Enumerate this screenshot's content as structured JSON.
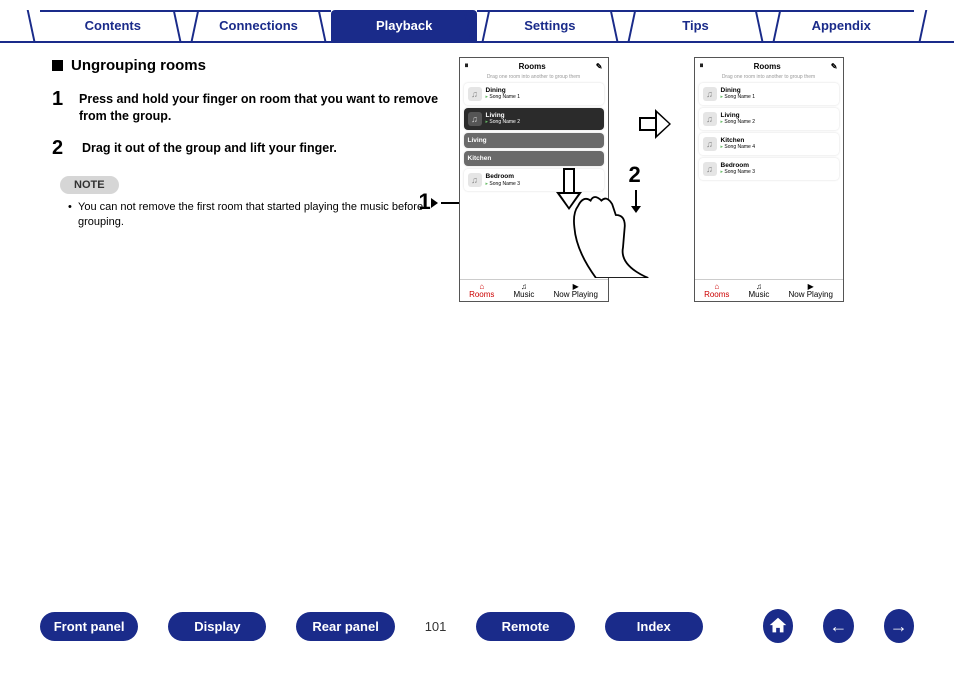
{
  "tabs": {
    "contents": "Contents",
    "connections": "Connections",
    "playback": "Playback",
    "settings": "Settings",
    "tips": "Tips",
    "appendix": "Appendix"
  },
  "section_title": "Ungrouping rooms",
  "steps": [
    {
      "num": "1",
      "text": "Press and hold your finger on room that you want to remove from the group."
    },
    {
      "num": "2",
      "text": "Drag it out of the group and lift your finger."
    }
  ],
  "note_label": "NOTE",
  "notes": [
    "You can not remove the first room that started playing the music before grouping."
  ],
  "callout1": "1",
  "callout2": "2",
  "phone": {
    "title": "Rooms",
    "subtitle": "Drag one room into another to group them",
    "footer": {
      "rooms": "Rooms",
      "music": "Music",
      "now": "Now Playing"
    }
  },
  "phone1_rows": [
    {
      "name": "Dining",
      "song": "Song Name 1",
      "style": "light"
    },
    {
      "name": "Living",
      "song": "Song Name 2",
      "style": "dark"
    },
    {
      "name": "Living",
      "song": "",
      "style": "mid"
    },
    {
      "name": "Kitchen",
      "song": "",
      "style": "mid"
    },
    {
      "name": "Bedroom",
      "song": "Song Name 3",
      "style": "light"
    }
  ],
  "phone2_rows": [
    {
      "name": "Dining",
      "song": "Song Name 1"
    },
    {
      "name": "Living",
      "song": "Song Name 2"
    },
    {
      "name": "Kitchen",
      "song": "Song Name 4"
    },
    {
      "name": "Bedroom",
      "song": "Song Name 3"
    }
  ],
  "bottom_nav": {
    "front_panel": "Front panel",
    "display": "Display",
    "rear_panel": "Rear panel",
    "remote": "Remote",
    "index": "Index"
  },
  "page_number": "101"
}
